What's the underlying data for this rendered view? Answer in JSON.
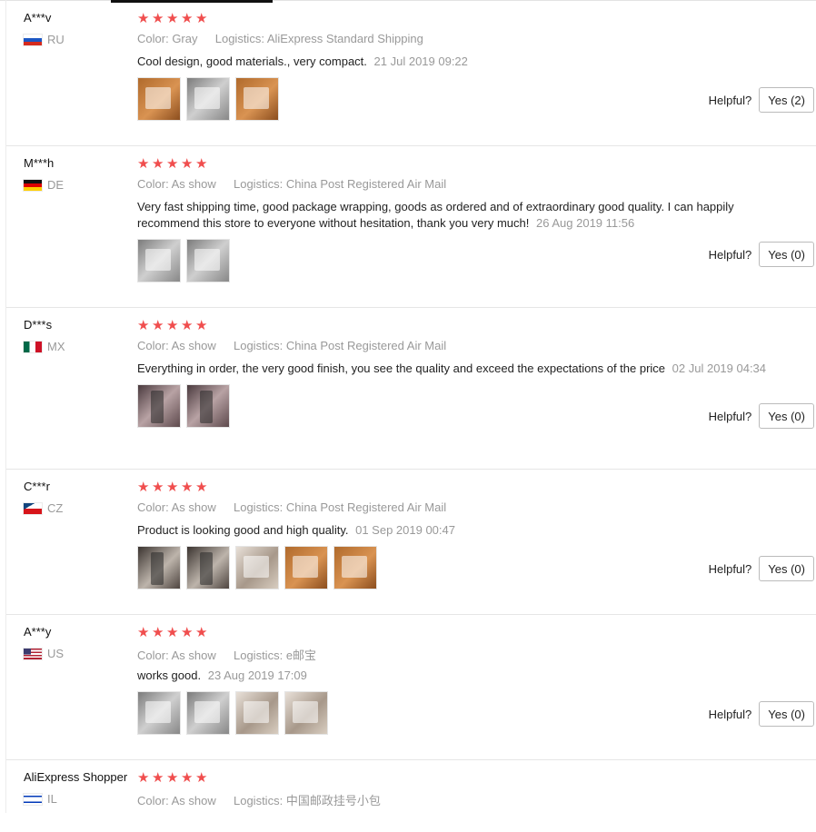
{
  "labels": {
    "color": "Color:",
    "logistics": "Logistics:",
    "helpful": "Helpful?"
  },
  "star_color": "#f04e4e",
  "reviews": [
    {
      "user": "A***v",
      "country": "RU",
      "flag": "russia-flag-icon",
      "rating": 5,
      "color": "Gray",
      "logistics": "AliExpress Standard Shipping",
      "text": "Cool design, good materials., very compact.",
      "date": "21 Jul 2019 09:22",
      "photos": [
        "product-photo",
        "product-photo",
        "product-photo"
      ],
      "helpful": "Yes (2)"
    },
    {
      "user": "M***h",
      "country": "DE",
      "flag": "germany-flag-icon",
      "rating": 5,
      "color": "As show",
      "logistics": "China Post Registered Air Mail",
      "text": "Very fast shipping time, good package wrapping, goods as ordered and of extraordinary good quality. I can happily recommend this store to everyone without hesitation, thank you very much!",
      "date": "26 Aug 2019 11:56",
      "photos": [
        "product-photo",
        "product-photo"
      ],
      "helpful": "Yes (0)"
    },
    {
      "user": "D***s",
      "country": "MX",
      "flag": "mexico-flag-icon",
      "rating": 5,
      "color": "As show",
      "logistics": "China Post Registered Air Mail",
      "text": "Everything in order, the very good finish, you see the quality and exceed the expectations of the price",
      "date": "02 Jul 2019 04:34",
      "photos": [
        "product-photo",
        "product-photo"
      ],
      "helpful": "Yes (0)"
    },
    {
      "user": "C***r",
      "country": "CZ",
      "flag": "czech-flag-icon",
      "rating": 5,
      "color": "As show",
      "logistics": "China Post Registered Air Mail",
      "text": "Product is looking good and high quality.",
      "date": "01 Sep 2019 00:47",
      "photos": [
        "product-photo",
        "product-photo",
        "product-photo",
        "product-photo",
        "product-photo"
      ],
      "helpful": "Yes (0)"
    },
    {
      "user": "A***y",
      "country": "US",
      "flag": "usa-flag-icon",
      "rating": 5,
      "color": "As show",
      "logistics": "e邮宝",
      "text": "works good.",
      "date": "23 Aug 2019 17:09",
      "photos": [
        "product-photo",
        "product-photo",
        "product-photo",
        "product-photo"
      ],
      "helpful": "Yes (0)"
    },
    {
      "user": "AliExpress Shopper",
      "country": "IL",
      "flag": "israel-flag-icon",
      "rating": 5,
      "color": "As show",
      "logistics": "中国邮政挂号小包",
      "text": "",
      "date": "",
      "photos": [],
      "helpful": ""
    }
  ]
}
